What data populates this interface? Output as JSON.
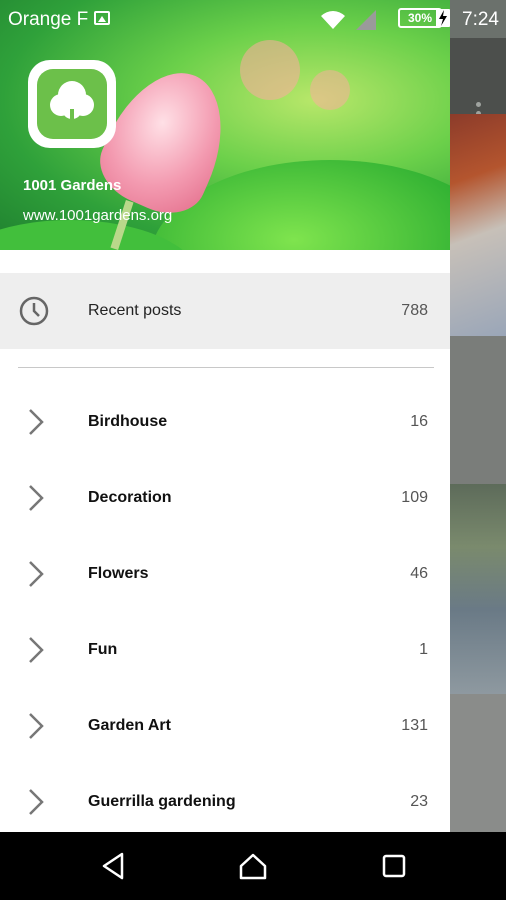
{
  "status_bar": {
    "carrier": "Orange F",
    "battery": "30%",
    "time": "7:24"
  },
  "drawer": {
    "header": {
      "site_name": "1001 Gardens",
      "site_url": "www.1001gardens.org"
    },
    "recent": {
      "label": "Recent posts",
      "count": "788",
      "icon": "clock-icon"
    },
    "categories": [
      {
        "label": "Birdhouse",
        "count": "16"
      },
      {
        "label": "Decoration",
        "count": "109"
      },
      {
        "label": "Flowers",
        "count": "46"
      },
      {
        "label": "Fun",
        "count": "1"
      },
      {
        "label": "Garden Art",
        "count": "131"
      },
      {
        "label": "Guerrilla gardening",
        "count": "23"
      }
    ]
  },
  "colors": {
    "accent": "#6cc04a",
    "recent_bg": "#eeeeee"
  }
}
